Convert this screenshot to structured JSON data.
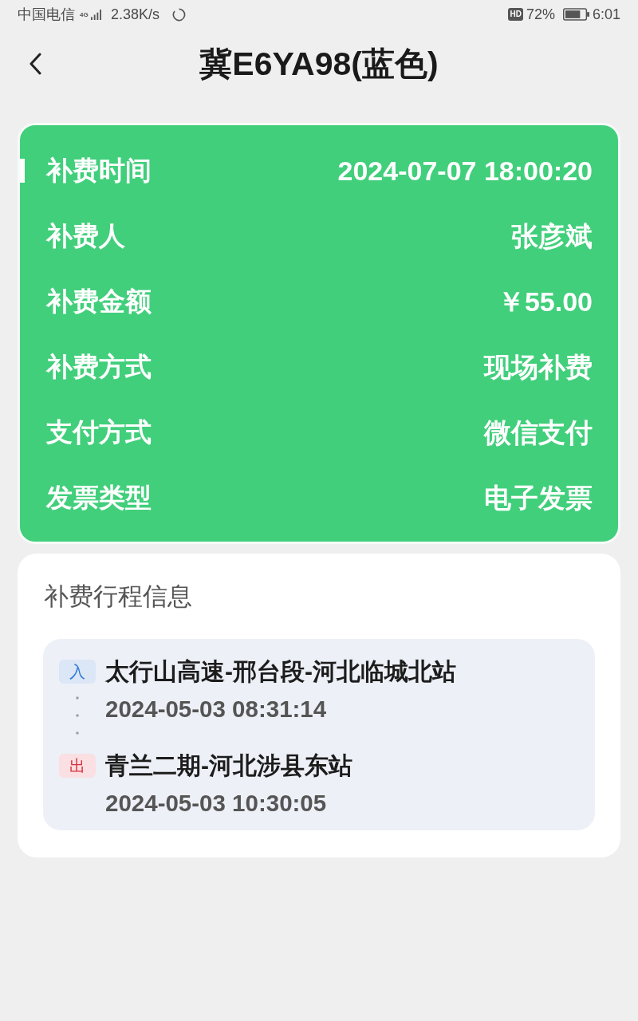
{
  "status_bar": {
    "carrier": "中国电信",
    "network": "4G",
    "speed": "2.38K/s",
    "hd": "HD",
    "battery": "72%",
    "time": "6:01"
  },
  "header": {
    "title": "冀E6YA98(蓝色)"
  },
  "details": [
    {
      "label": "补费时间",
      "value": "2024-07-07 18:00:20",
      "marked": true
    },
    {
      "label": "补费人",
      "value": "张彦斌",
      "marked": false
    },
    {
      "label": "补费金额",
      "value": "￥55.00",
      "marked": false
    },
    {
      "label": "补费方式",
      "value": "现场补费",
      "marked": false
    },
    {
      "label": "支付方式",
      "value": "微信支付",
      "marked": false
    },
    {
      "label": "发票类型",
      "value": "电子发票",
      "marked": false
    }
  ],
  "trip": {
    "title": "补费行程信息",
    "stops": [
      {
        "kind": "entry",
        "badge": "入",
        "station": "太行山高速-邢台段-河北临城北站",
        "time": "2024-05-03 08:31:14"
      },
      {
        "kind": "exit",
        "badge": "出",
        "station": "青兰二期-河北涉县东站",
        "time": "2024-05-03 10:30:05"
      }
    ]
  }
}
